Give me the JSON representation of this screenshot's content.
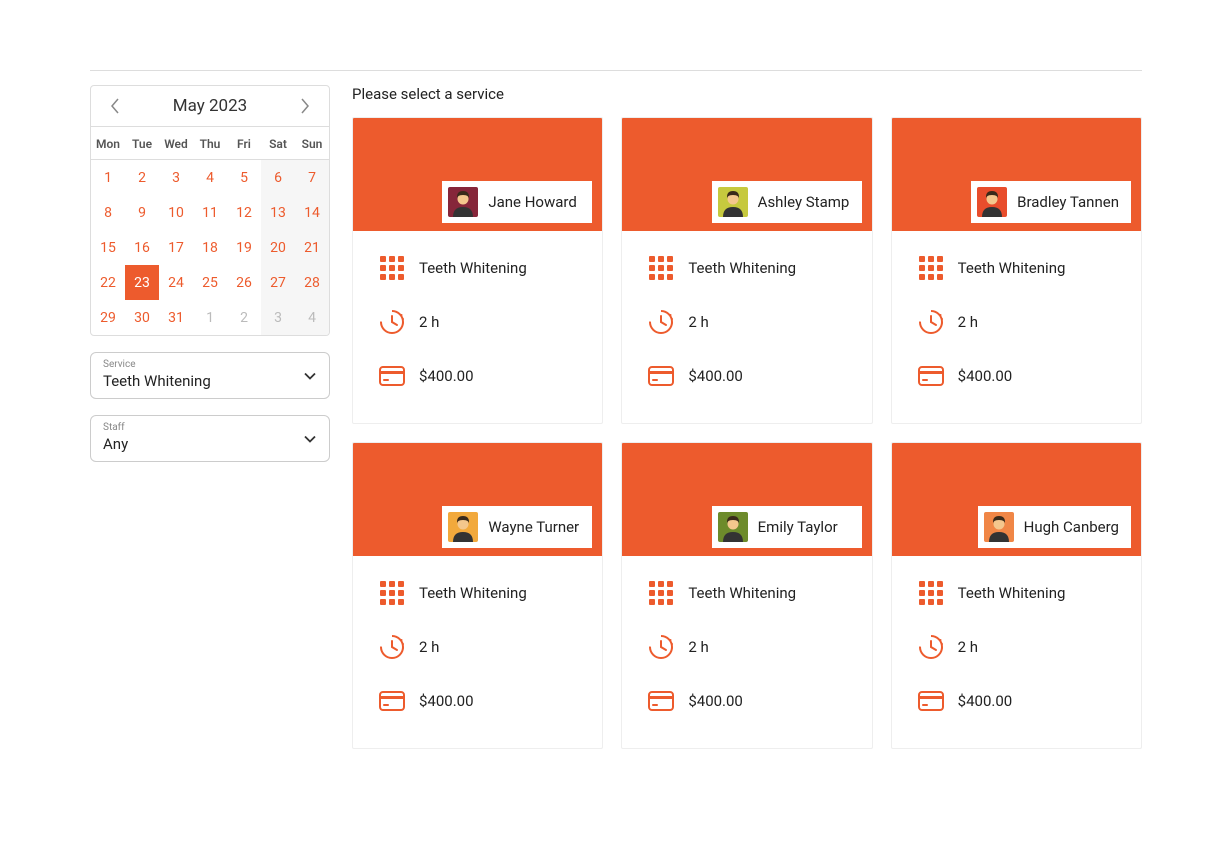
{
  "calendar": {
    "title": "May 2023",
    "dow": [
      "Mon",
      "Tue",
      "Wed",
      "Thu",
      "Fri",
      "Sat",
      "Sun"
    ],
    "weeks": [
      [
        {
          "d": 1,
          "active": true
        },
        {
          "d": 2,
          "active": true
        },
        {
          "d": 3,
          "active": true
        },
        {
          "d": 4,
          "active": true
        },
        {
          "d": 5,
          "active": true
        },
        {
          "d": 6,
          "active": true,
          "weekend": true
        },
        {
          "d": 7,
          "active": true,
          "weekend": true
        }
      ],
      [
        {
          "d": 8,
          "active": true
        },
        {
          "d": 9,
          "active": true
        },
        {
          "d": 10,
          "active": true
        },
        {
          "d": 11,
          "active": true
        },
        {
          "d": 12,
          "active": true
        },
        {
          "d": 13,
          "active": true,
          "weekend": true
        },
        {
          "d": 14,
          "active": true,
          "weekend": true
        }
      ],
      [
        {
          "d": 15,
          "active": true
        },
        {
          "d": 16,
          "active": true
        },
        {
          "d": 17,
          "active": true
        },
        {
          "d": 18,
          "active": true
        },
        {
          "d": 19,
          "active": true
        },
        {
          "d": 20,
          "active": true,
          "weekend": true
        },
        {
          "d": 21,
          "active": true,
          "weekend": true
        }
      ],
      [
        {
          "d": 22,
          "active": true
        },
        {
          "d": 23,
          "active": true,
          "selected": true
        },
        {
          "d": 24,
          "active": true
        },
        {
          "d": 25,
          "active": true
        },
        {
          "d": 26,
          "active": true
        },
        {
          "d": 27,
          "active": true,
          "weekend": true
        },
        {
          "d": 28,
          "active": true,
          "weekend": true
        }
      ],
      [
        {
          "d": 29,
          "active": true
        },
        {
          "d": 30,
          "active": true
        },
        {
          "d": 31,
          "active": true
        },
        {
          "d": 1,
          "other": true
        },
        {
          "d": 2,
          "other": true
        },
        {
          "d": 3,
          "other": true,
          "weekend": true
        },
        {
          "d": 4,
          "other": true,
          "weekend": true
        }
      ]
    ]
  },
  "filters": {
    "service": {
      "label": "Service",
      "value": "Teeth Whitening"
    },
    "staff": {
      "label": "Staff",
      "value": "Any"
    }
  },
  "main": {
    "title": "Please select a service"
  },
  "cards": [
    {
      "staff": "Jane Howard",
      "avatarBg": "#86263a",
      "service": "Teeth Whitening",
      "duration": "2 h",
      "price": "$400.00"
    },
    {
      "staff": "Ashley Stamp",
      "avatarBg": "#c6c93e",
      "service": "Teeth Whitening",
      "duration": "2 h",
      "price": "$400.00"
    },
    {
      "staff": "Bradley Tannen",
      "avatarBg": "#e84d2c",
      "service": "Teeth Whitening",
      "duration": "2 h",
      "price": "$400.00"
    },
    {
      "staff": "Wayne Turner",
      "avatarBg": "#f2a93c",
      "service": "Teeth Whitening",
      "duration": "2 h",
      "price": "$400.00"
    },
    {
      "staff": "Emily Taylor",
      "avatarBg": "#6d8b2b",
      "service": "Teeth Whitening",
      "duration": "2 h",
      "price": "$400.00"
    },
    {
      "staff": "Hugh Canberg",
      "avatarBg": "#f08646",
      "service": "Teeth Whitening",
      "duration": "2 h",
      "price": "$400.00"
    }
  ]
}
